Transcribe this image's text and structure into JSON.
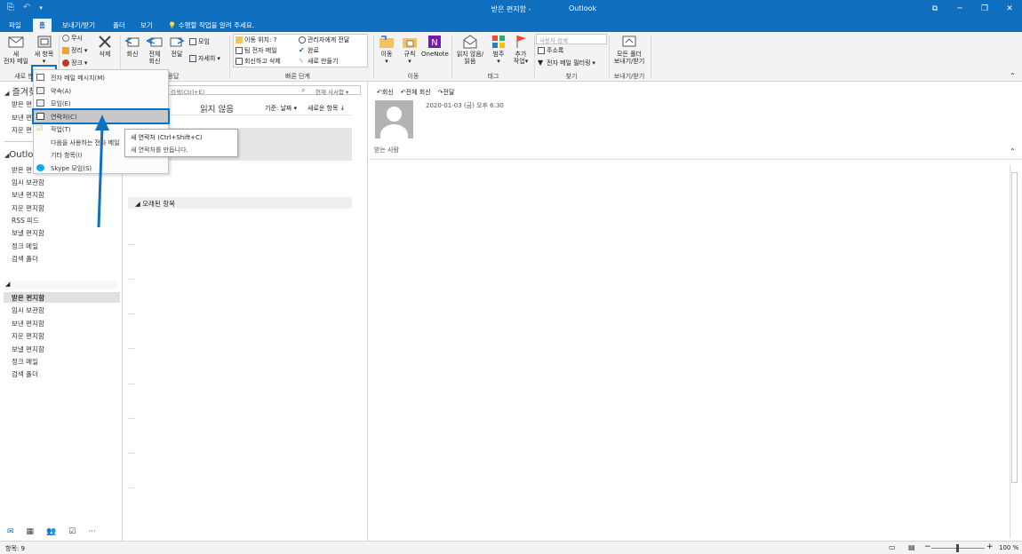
{
  "window": {
    "title": "받은 편지함 -",
    "app_name": "Outlook",
    "controls": [
      "⧉",
      "─",
      "❐",
      "✕"
    ]
  },
  "tabs": [
    {
      "label": "파일"
    },
    {
      "label": "홈"
    },
    {
      "label": "보내기/받기"
    },
    {
      "label": "폴더"
    },
    {
      "label": "보기"
    }
  ],
  "tell_me": "수행할 작업을 알려 주세요.",
  "ribbon": {
    "new_email_line1": "새",
    "new_email_line2": "전자 메일",
    "new_items_line1": "새 항목",
    "ignore": "무시",
    "cleanup": "정리",
    "junk": "정크",
    "delete": "삭제",
    "reply": "회신",
    "reply_all_line1": "전체",
    "reply_all_line2": "회신",
    "forward": "전달",
    "meeting": "모임",
    "more": "자세히",
    "quick_steps": [
      "이동 위치: ?",
      "팀 전자 메일",
      "회신하고 삭제",
      "관리자에게 전달",
      "완료",
      "새로 만들기"
    ],
    "move": "이동",
    "rules": "규칙",
    "onenote": "OneNote",
    "unread_line1": "읽지 않음/",
    "unread_line2": "읽음",
    "categorize": "범주",
    "followup_line1": "추가",
    "followup_line2": "작업",
    "search_people_placeholder": "사용자 검색",
    "address_book": "주소록",
    "filter_email": "전자 메일 필터링",
    "sendrecv_line1": "모든 폴더",
    "sendrecv_line2": "보내기/받기",
    "groups": {
      "new": "새로 만",
      "respond": "응답",
      "quick_steps": "빠른 단계",
      "move": "이동",
      "tags": "태그",
      "find": "찾기",
      "send_receive": "보내기/받기"
    }
  },
  "dropdown": {
    "items": [
      {
        "label": "전자 메일 메시지(M)"
      },
      {
        "label": "약속(A)"
      },
      {
        "label": "모임(E)"
      },
      {
        "label": "연락처(C)"
      },
      {
        "label": "작업(T)"
      },
      {
        "label": "다음을 사용하는 전자 메일"
      },
      {
        "label": "기타 항목(I)"
      },
      {
        "label": "Skype 모임(S)"
      }
    ]
  },
  "tooltip": {
    "title": "새 연락처 (Ctrl+Shift+C)",
    "desc": "새 연락처를 만듭니다."
  },
  "folders": {
    "favorites": "즐겨찾",
    "fav_items": [
      "받은 편",
      "보낸 편",
      "지운 편"
    ],
    "account": "Outlo",
    "account_items": [
      "받은 편",
      "임시 보관함",
      "보낸 편지함",
      "지운 편지함",
      "RSS 피드",
      "보낼 편지함",
      "정크 메일",
      "검색 폴더"
    ],
    "account2_items": [
      "받은 편지함",
      "임시 보관함",
      "보낸 편지함",
      "지운 편지함",
      "보낼 편지함",
      "정크 메일",
      "검색 폴더"
    ]
  },
  "nav_icons": [
    "mail-icon",
    "calendar-icon",
    "people-icon",
    "tasks-icon",
    "more-icon"
  ],
  "message_list": {
    "search_placeholder": "검색(Ctrl+E)",
    "scope": "현재 사서함",
    "filter_unread": "읽지 않음",
    "sort_by": "기준: 날짜",
    "sort_order": "새로운 항목 ↓",
    "group_older": "오래된 항목"
  },
  "reading": {
    "reply": "회신",
    "reply_all": "전체 회신",
    "forward": "전달",
    "date": "2020-01-03 (금) 오후 6:30",
    "recipients_label": "받는 사람"
  },
  "status": {
    "items": "항목: 9",
    "zoom": "100 %"
  },
  "colors": {
    "accent": "#106ebe",
    "highlight": "#1070c0"
  }
}
